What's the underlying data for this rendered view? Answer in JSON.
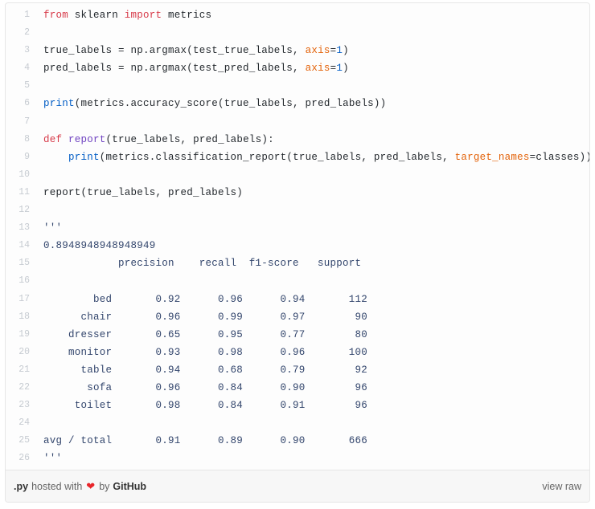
{
  "gist": {
    "footer": {
      "file_extension": ".py",
      "hosted_with": "hosted with",
      "heart_icon": "heart-icon",
      "heart_glyph": "❤",
      "by": "by",
      "host": "GitHub",
      "view_raw": "view raw"
    },
    "colors": {
      "keyword": "#d73a49",
      "function": "#6f42c1",
      "builtin": "#005cc5",
      "number": "#005cc5",
      "kwarg": "#e36209",
      "plain": "#24292e",
      "output": "#32456c",
      "line_number": "#c6cbd1",
      "border": "#e6e6e6",
      "footer_bg": "#f7f7f7",
      "heart": "#e8252a"
    },
    "lines": [
      {
        "n": "1",
        "tokens": [
          {
            "t": "from",
            "c": "k"
          },
          {
            "t": " sklearn ",
            "c": "pl"
          },
          {
            "t": "import",
            "c": "k"
          },
          {
            "t": " metrics",
            "c": "pl"
          }
        ]
      },
      {
        "n": "2",
        "tokens": []
      },
      {
        "n": "3",
        "tokens": [
          {
            "t": "true_labels = np.argmax(test_true_labels, ",
            "c": "pl"
          },
          {
            "t": "axis",
            "c": "kw"
          },
          {
            "t": "=",
            "c": "pl"
          },
          {
            "t": "1",
            "c": "num"
          },
          {
            "t": ")",
            "c": "pl"
          }
        ]
      },
      {
        "n": "4",
        "tokens": [
          {
            "t": "pred_labels = np.argmax(test_pred_labels, ",
            "c": "pl"
          },
          {
            "t": "axis",
            "c": "kw"
          },
          {
            "t": "=",
            "c": "pl"
          },
          {
            "t": "1",
            "c": "num"
          },
          {
            "t": ")",
            "c": "pl"
          }
        ]
      },
      {
        "n": "5",
        "tokens": []
      },
      {
        "n": "6",
        "tokens": [
          {
            "t": "print",
            "c": "bi"
          },
          {
            "t": "(metrics.accuracy_score(true_labels, pred_labels))",
            "c": "pl"
          }
        ]
      },
      {
        "n": "7",
        "tokens": []
      },
      {
        "n": "8",
        "tokens": [
          {
            "t": "def",
            "c": "k"
          },
          {
            "t": " ",
            "c": "pl"
          },
          {
            "t": "report",
            "c": "fn"
          },
          {
            "t": "(true_labels, pred_labels):",
            "c": "pl"
          }
        ]
      },
      {
        "n": "9",
        "tokens": [
          {
            "t": "    ",
            "c": "pl"
          },
          {
            "t": "print",
            "c": "bi"
          },
          {
            "t": "(metrics.classification_report(true_labels, pred_labels, ",
            "c": "pl"
          },
          {
            "t": "target_names",
            "c": "kw"
          },
          {
            "t": "=",
            "c": "pl"
          },
          {
            "t": "classes))",
            "c": "pl"
          }
        ]
      },
      {
        "n": "10",
        "tokens": []
      },
      {
        "n": "11",
        "tokens": [
          {
            "t": "report(true_labels, pred_labels)",
            "c": "pl"
          }
        ]
      },
      {
        "n": "12",
        "tokens": []
      },
      {
        "n": "13",
        "tokens": [
          {
            "t": "'''",
            "c": "out"
          }
        ]
      },
      {
        "n": "14",
        "tokens": [
          {
            "t": "0.8948948948948949",
            "c": "out"
          }
        ]
      },
      {
        "n": "15",
        "tokens": [
          {
            "t": "            precision    recall  f1-score   support",
            "c": "out"
          }
        ]
      },
      {
        "n": "16",
        "tokens": []
      },
      {
        "n": "17",
        "tokens": [
          {
            "t": "        bed       0.92      0.96      0.94       112",
            "c": "out"
          }
        ]
      },
      {
        "n": "18",
        "tokens": [
          {
            "t": "      chair       0.96      0.99      0.97        90",
            "c": "out"
          }
        ]
      },
      {
        "n": "19",
        "tokens": [
          {
            "t": "    dresser       0.65      0.95      0.77        80",
            "c": "out"
          }
        ]
      },
      {
        "n": "20",
        "tokens": [
          {
            "t": "    monitor       0.93      0.98      0.96       100",
            "c": "out"
          }
        ]
      },
      {
        "n": "21",
        "tokens": [
          {
            "t": "      table       0.94      0.68      0.79        92",
            "c": "out"
          }
        ]
      },
      {
        "n": "22",
        "tokens": [
          {
            "t": "       sofa       0.96      0.84      0.90        96",
            "c": "out"
          }
        ]
      },
      {
        "n": "23",
        "tokens": [
          {
            "t": "     toilet       0.98      0.84      0.91        96",
            "c": "out"
          }
        ]
      },
      {
        "n": "24",
        "tokens": []
      },
      {
        "n": "25",
        "tokens": [
          {
            "t": "avg / total       0.91      0.89      0.90       666",
            "c": "out"
          }
        ]
      },
      {
        "n": "26",
        "tokens": [
          {
            "t": "'''",
            "c": "out"
          }
        ]
      }
    ],
    "report": {
      "accuracy": "0.8948948948948949",
      "columns": [
        "precision",
        "recall",
        "f1-score",
        "support"
      ],
      "rows": [
        {
          "label": "bed",
          "precision": "0.92",
          "recall": "0.96",
          "f1_score": "0.94",
          "support": "112"
        },
        {
          "label": "chair",
          "precision": "0.96",
          "recall": "0.99",
          "f1_score": "0.97",
          "support": "90"
        },
        {
          "label": "dresser",
          "precision": "0.65",
          "recall": "0.95",
          "f1_score": "0.77",
          "support": "80"
        },
        {
          "label": "monitor",
          "precision": "0.93",
          "recall": "0.98",
          "f1_score": "0.96",
          "support": "100"
        },
        {
          "label": "table",
          "precision": "0.94",
          "recall": "0.68",
          "f1_score": "0.79",
          "support": "92"
        },
        {
          "label": "sofa",
          "precision": "0.96",
          "recall": "0.84",
          "f1_score": "0.90",
          "support": "96"
        },
        {
          "label": "toilet",
          "precision": "0.98",
          "recall": "0.84",
          "f1_score": "0.91",
          "support": "96"
        }
      ],
      "total": {
        "label": "avg / total",
        "precision": "0.91",
        "recall": "0.89",
        "f1_score": "0.90",
        "support": "666"
      }
    }
  }
}
